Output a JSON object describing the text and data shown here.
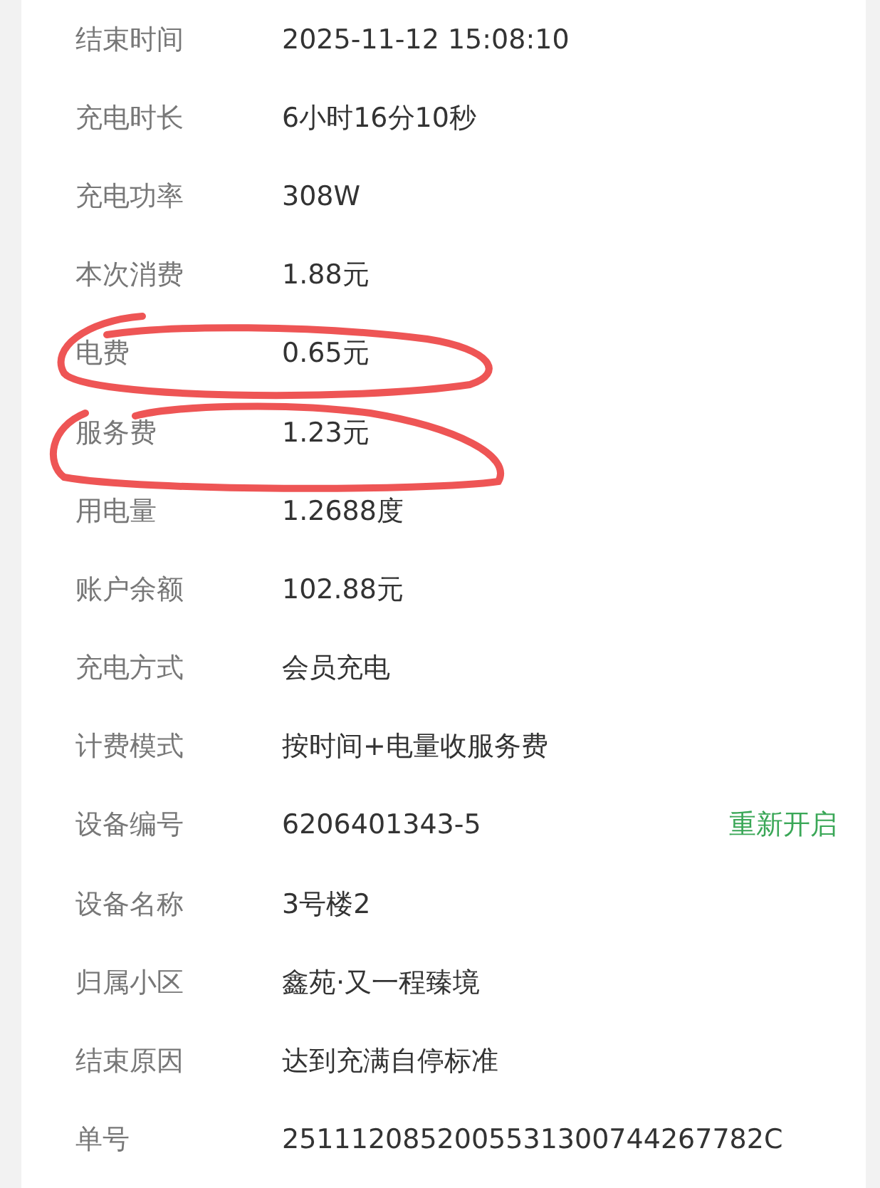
{
  "rows": [
    {
      "label": "结束时间",
      "value": "2025-11-12 15:08:10"
    },
    {
      "label": "充电时长",
      "value": "6小时16分10秒"
    },
    {
      "label": "充电功率",
      "value": "308W"
    },
    {
      "label": "本次消费",
      "value": "1.88元"
    },
    {
      "label": "电费",
      "value": "0.65元"
    },
    {
      "label": "服务费",
      "value": "1.23元"
    },
    {
      "label": "用电量",
      "value": "1.2688度"
    },
    {
      "label": "账户余额",
      "value": "102.88元"
    },
    {
      "label": "充电方式",
      "value": "会员充电"
    },
    {
      "label": "计费模式",
      "value": "按时间+电量收服务费"
    },
    {
      "label": "设备编号",
      "value": "6206401343-5",
      "action": "重新开启"
    },
    {
      "label": "设备名称",
      "value": "3号楼2"
    },
    {
      "label": "归属小区",
      "value": "鑫苑·又一程臻境"
    },
    {
      "label": "结束原因",
      "value": "达到充满自停标准"
    },
    {
      "label": "单号",
      "value": "2511120852005531300744267782C"
    }
  ]
}
